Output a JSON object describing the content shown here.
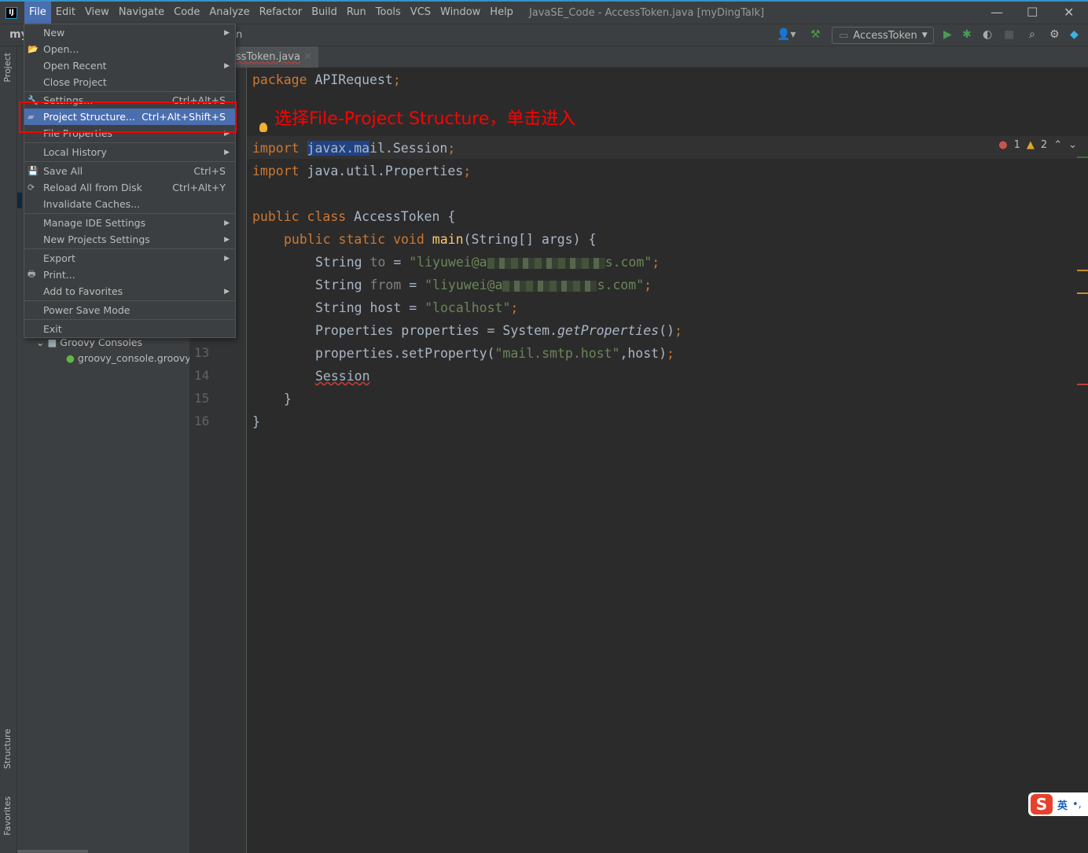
{
  "menubar": {
    "items": [
      "File",
      "Edit",
      "View",
      "Navigate",
      "Code",
      "Analyze",
      "Refactor",
      "Build",
      "Run",
      "Tools",
      "VCS",
      "Window",
      "Help"
    ],
    "window_title": "JavaSE_Code - AccessToken.java [myDingTalk]"
  },
  "toolbar": {
    "breadcrumb": "my",
    "breadcrumb_tail": "n",
    "run_config": "AccessToken"
  },
  "sidebar": {
    "project_tab": "Project",
    "structure_tab": "Structure",
    "favorites_tab": "Favorites"
  },
  "editor_tab": {
    "filename": "ssToken.java"
  },
  "inspections": {
    "errors": "1",
    "warnings": "2"
  },
  "annotation": "选择File-Project Structure，单击进入",
  "file_menu": [
    {
      "label": "New",
      "submenu": true
    },
    {
      "label": "Open...",
      "icon": "folder-open-icon"
    },
    {
      "label": "Open Recent",
      "submenu": true
    },
    {
      "label": "Close Project"
    },
    {
      "label": "Settings...",
      "shortcut": "Ctrl+Alt+S",
      "icon": "wrench-icon"
    },
    {
      "label": "Project Structure...",
      "shortcut": "Ctrl+Alt+Shift+S",
      "icon": "project-structure-icon",
      "highlighted": true
    },
    {
      "label": "File Properties",
      "submenu": true
    },
    {
      "label": "Local History",
      "submenu": true
    },
    {
      "label": "Save All",
      "shortcut": "Ctrl+S",
      "icon": "save-icon"
    },
    {
      "label": "Reload All from Disk",
      "shortcut": "Ctrl+Alt+Y",
      "icon": "reload-icon"
    },
    {
      "label": "Invalidate Caches..."
    },
    {
      "label": "Manage IDE Settings",
      "submenu": true
    },
    {
      "label": "New Projects Settings",
      "submenu": true
    },
    {
      "label": "Export",
      "submenu": true
    },
    {
      "label": "Print...",
      "icon": "print-icon"
    },
    {
      "label": "Add to Favorites",
      "submenu": true
    },
    {
      "label": "Power Save Mode"
    },
    {
      "label": "Exit"
    }
  ],
  "project_tree": {
    "groovy_consoles": "Groovy Consoles",
    "groovy_file": "groovy_console.groovy"
  },
  "line_numbers": [
    "13",
    "14",
    "15",
    "16"
  ],
  "code": {
    "package_kw": "package",
    "package_name": " APIRequest",
    "semi": ";",
    "import_kw": "import",
    "import1_sel": "javax.ma",
    "import1_rest": "il.Session",
    "import2": " java.util.Properties",
    "public": "public",
    "class": "class",
    "classname": " AccessToken {",
    "static": "static",
    "void": "void",
    "main": "main",
    "main_args": "(String[] args) {",
    "string_type": "String",
    "var_to": "to",
    "var_from": "from",
    "var_host": "host",
    "eq": " = ",
    "to_prefix": "\"liyuwei@a",
    "to_suffix": "s.com\"",
    "from_prefix": "\"liyuwei@a",
    "from_suffix": "s.com\"",
    "host_val": "\"localhost\"",
    "props_decl": "Properties properties = System.",
    "get_props": "getProperties",
    "parens": "()",
    "set_prop": "properties.setProperty(",
    "smtp_key": "\"mail.smtp.host\"",
    "set_prop_end": ",host)",
    "session": "Session",
    "close_inner": "}",
    "close_outer": "}"
  },
  "ime": {
    "label": "英",
    "punct": "•,"
  },
  "colors": {
    "keyword": "#cc7832",
    "string": "#6a8759",
    "method": "#ffc66d",
    "selection": "#4b6eaf",
    "annotation": "#ff0000"
  }
}
